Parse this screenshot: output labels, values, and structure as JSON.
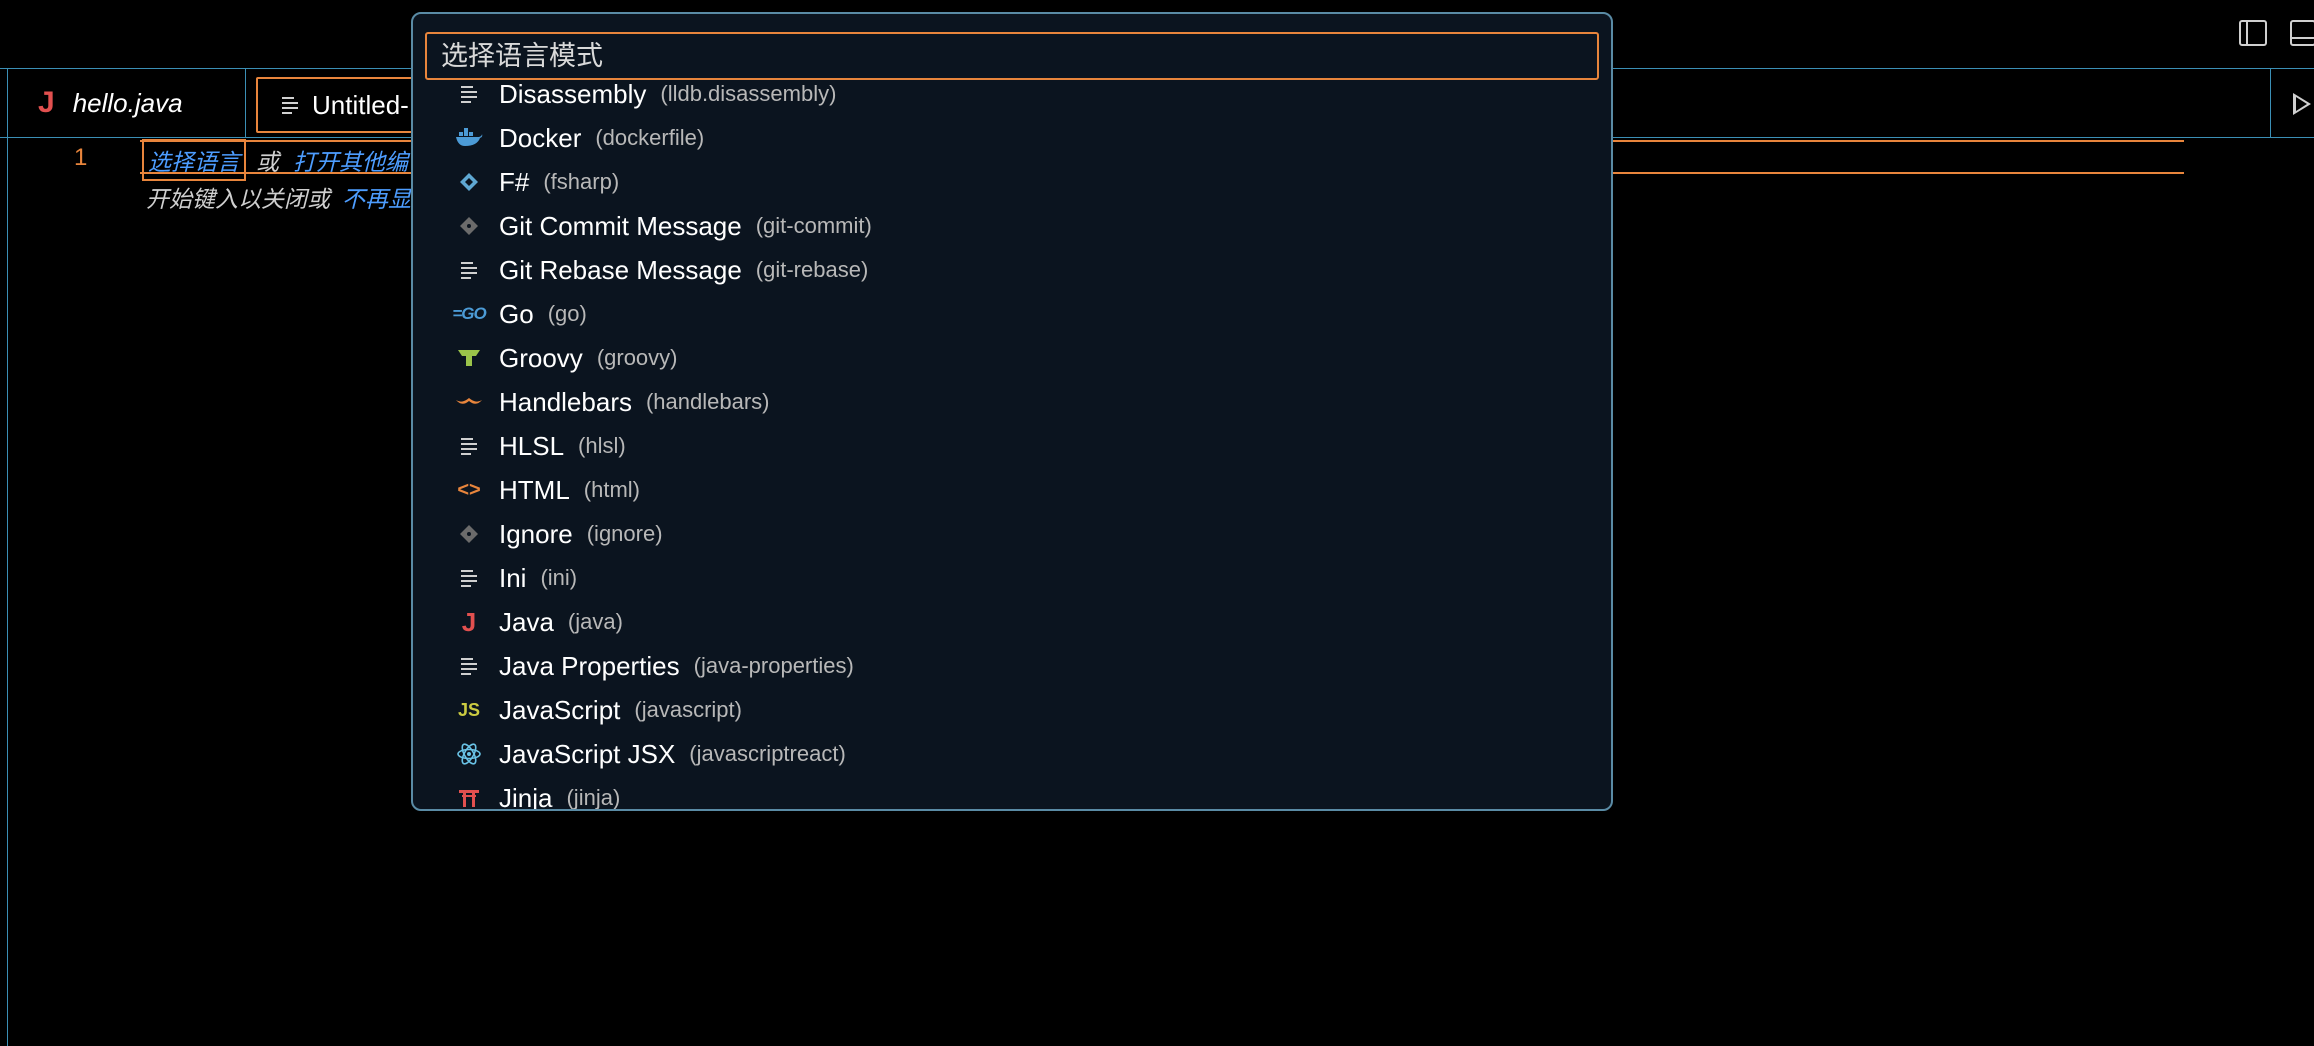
{
  "tabs": [
    {
      "label": "hello.java",
      "icon": "java-icon",
      "italic": true
    },
    {
      "label": "Untitled-",
      "icon": "lines-icon",
      "active": true
    }
  ],
  "editor": {
    "line_number": "1",
    "hint_line1": {
      "link1": "选择语言",
      "or": "或",
      "link2": "打开其他编"
    },
    "hint_line2": {
      "text": "开始键入以关闭或",
      "link": "不再显"
    }
  },
  "quickpick": {
    "placeholder": "选择语言模式",
    "items": [
      {
        "name": "Disassembly",
        "id": "(lldb.disassembly)",
        "icon": "lines-icon",
        "color": "#d0d0d0"
      },
      {
        "name": "Docker",
        "id": "(dockerfile)",
        "icon": "docker-icon",
        "color": "#4c9bd6"
      },
      {
        "name": "F#",
        "id": "(fsharp)",
        "icon": "fsharp-icon",
        "color": "#5fa8d3"
      },
      {
        "name": "Git Commit Message",
        "id": "(git-commit)",
        "icon": "git-icon",
        "color": "#6b6b6b"
      },
      {
        "name": "Git Rebase Message",
        "id": "(git-rebase)",
        "icon": "lines-icon",
        "color": "#d0d0d0"
      },
      {
        "name": "Go",
        "id": "(go)",
        "icon": "go-icon",
        "color": "#4c9bd6"
      },
      {
        "name": "Groovy",
        "id": "(groovy)",
        "icon": "groovy-icon",
        "color": "#9bc44a"
      },
      {
        "name": "Handlebars",
        "id": "(handlebars)",
        "icon": "handlebars-icon",
        "color": "#e8853c"
      },
      {
        "name": "HLSL",
        "id": "(hlsl)",
        "icon": "lines-icon",
        "color": "#d0d0d0"
      },
      {
        "name": "HTML",
        "id": "(html)",
        "icon": "html-icon",
        "color": "#e8853c"
      },
      {
        "name": "Ignore",
        "id": "(ignore)",
        "icon": "git-icon",
        "color": "#6b6b6b"
      },
      {
        "name": "Ini",
        "id": "(ini)",
        "icon": "lines-icon",
        "color": "#d0d0d0"
      },
      {
        "name": "Java",
        "id": "(java)",
        "icon": "java-icon",
        "color": "#e2504f"
      },
      {
        "name": "Java Properties",
        "id": "(java-properties)",
        "icon": "lines-icon",
        "color": "#d0d0d0"
      },
      {
        "name": "JavaScript",
        "id": "(javascript)",
        "icon": "javascript-icon",
        "color": "#cbcb41"
      },
      {
        "name": "JavaScript JSX",
        "id": "(javascriptreact)",
        "icon": "react-icon",
        "color": "#6ac3e6"
      },
      {
        "name": "Jinja",
        "id": "(jinja)",
        "icon": "jinja-icon",
        "color": "#e2504f"
      }
    ]
  }
}
